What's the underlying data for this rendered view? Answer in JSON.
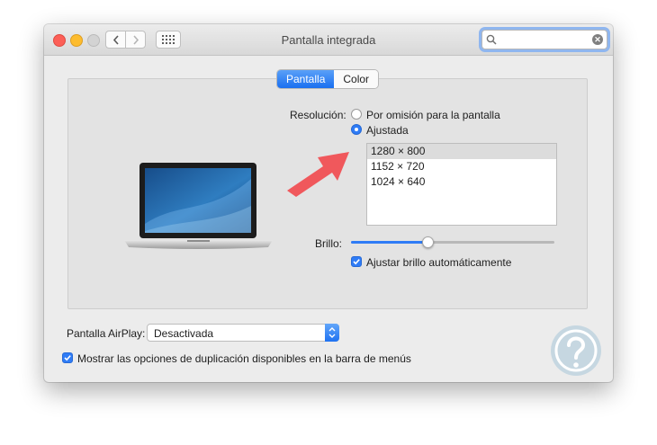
{
  "window": {
    "title": "Pantalla integrada",
    "search": {
      "value": "",
      "placeholder": ""
    }
  },
  "tabs": [
    {
      "label": "Pantalla",
      "active": true
    },
    {
      "label": "Color",
      "active": false
    }
  ],
  "resolution": {
    "label": "Resolución:",
    "options": [
      {
        "label": "Por omisión para la pantalla",
        "selected": false
      },
      {
        "label": "Ajustada",
        "selected": true
      }
    ],
    "list": [
      {
        "label": "1280 × 800",
        "selected": true
      },
      {
        "label": "1152 × 720",
        "selected": false
      },
      {
        "label": "1024 × 640",
        "selected": false
      }
    ]
  },
  "brightness": {
    "label": "Brillo:",
    "level": 0.38,
    "auto_label": "Ajustar brillo automáticamente",
    "auto_checked": true
  },
  "airplay": {
    "label": "Pantalla AirPlay:",
    "value": "Desactivada"
  },
  "mirror": {
    "label": "Mostrar las opciones de duplicación disponibles en la barra de menús",
    "checked": true
  },
  "colors": {
    "accent": "#2f7cf6",
    "arrow": "#f0585c",
    "close": "#fc5f57",
    "minimize": "#fdbc2e",
    "logo": "#a8c6d8"
  },
  "icons": [
    "back-arrow-icon",
    "forward-arrow-icon",
    "grid-icon",
    "search-icon",
    "clear-icon",
    "checkmark-icon",
    "stepper-icon",
    "laptop-icon",
    "red-arrow-icon",
    "solvetic-logo"
  ]
}
